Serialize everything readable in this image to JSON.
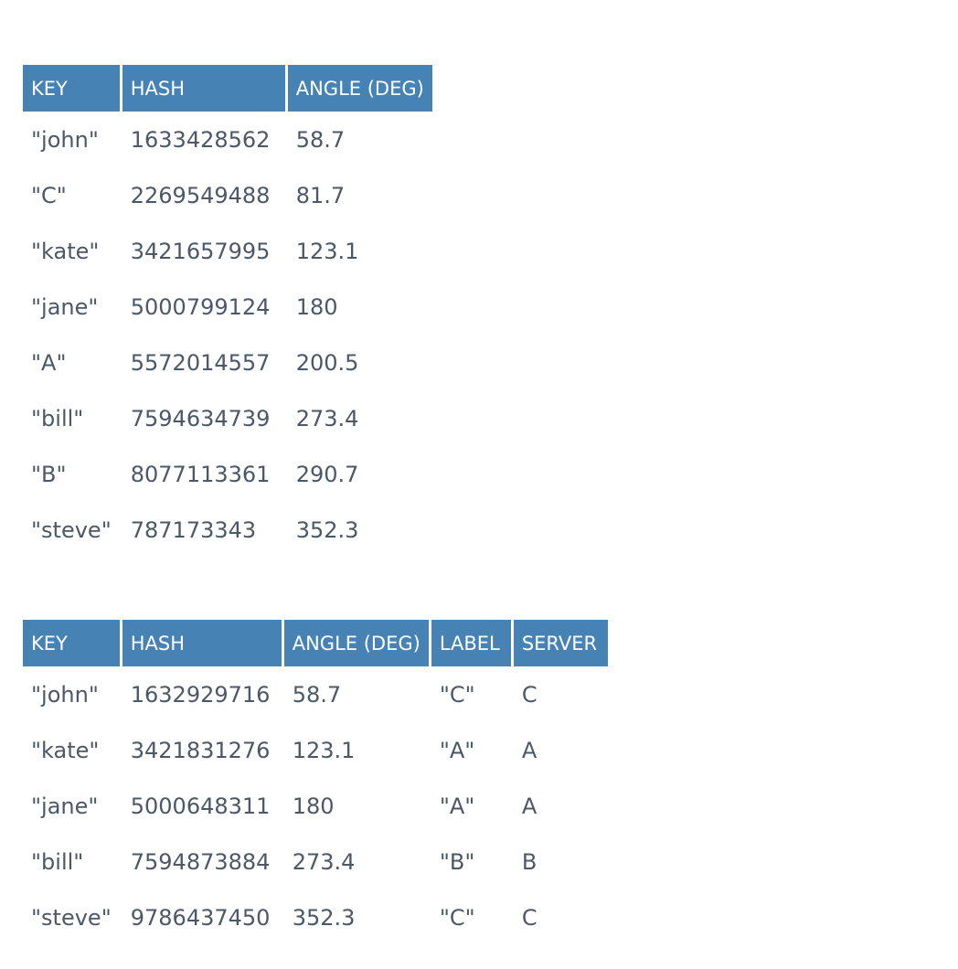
{
  "table1": {
    "headers": [
      "KEY",
      "HASH",
      "ANGLE (DEG)"
    ],
    "rows": [
      [
        "\"john\"",
        "1633428562",
        "58.7"
      ],
      [
        "\"C\"",
        "2269549488",
        "81.7"
      ],
      [
        "\"kate\"",
        "3421657995",
        "123.1"
      ],
      [
        "\"jane\"",
        "5000799124",
        "180"
      ],
      [
        "\"A\"",
        "5572014557",
        "200.5"
      ],
      [
        "\"bill\"",
        "7594634739",
        "273.4"
      ],
      [
        "\"B\"",
        "8077113361",
        "290.7"
      ],
      [
        "\"steve\"",
        "787173343",
        "352.3"
      ]
    ]
  },
  "table2": {
    "headers": [
      "KEY",
      "HASH",
      "ANGLE (DEG)",
      "LABEL",
      "SERVER"
    ],
    "rows": [
      [
        "\"john\"",
        "1632929716",
        "58.7",
        "\"C\"",
        "C"
      ],
      [
        "\"kate\"",
        "3421831276",
        "123.1",
        "\"A\"",
        "A"
      ],
      [
        "\"jane\"",
        "5000648311",
        "180",
        "\"A\"",
        "A"
      ],
      [
        "\"bill\"",
        "7594873884",
        "273.4",
        "\"B\"",
        "B"
      ],
      [
        "\"steve\"",
        "9786437450",
        "352.3",
        "\"C\"",
        "C"
      ]
    ]
  },
  "colors": {
    "header_bg": "#4682b4",
    "header_text": "#ffffff",
    "cell_text": "#4a5868"
  }
}
